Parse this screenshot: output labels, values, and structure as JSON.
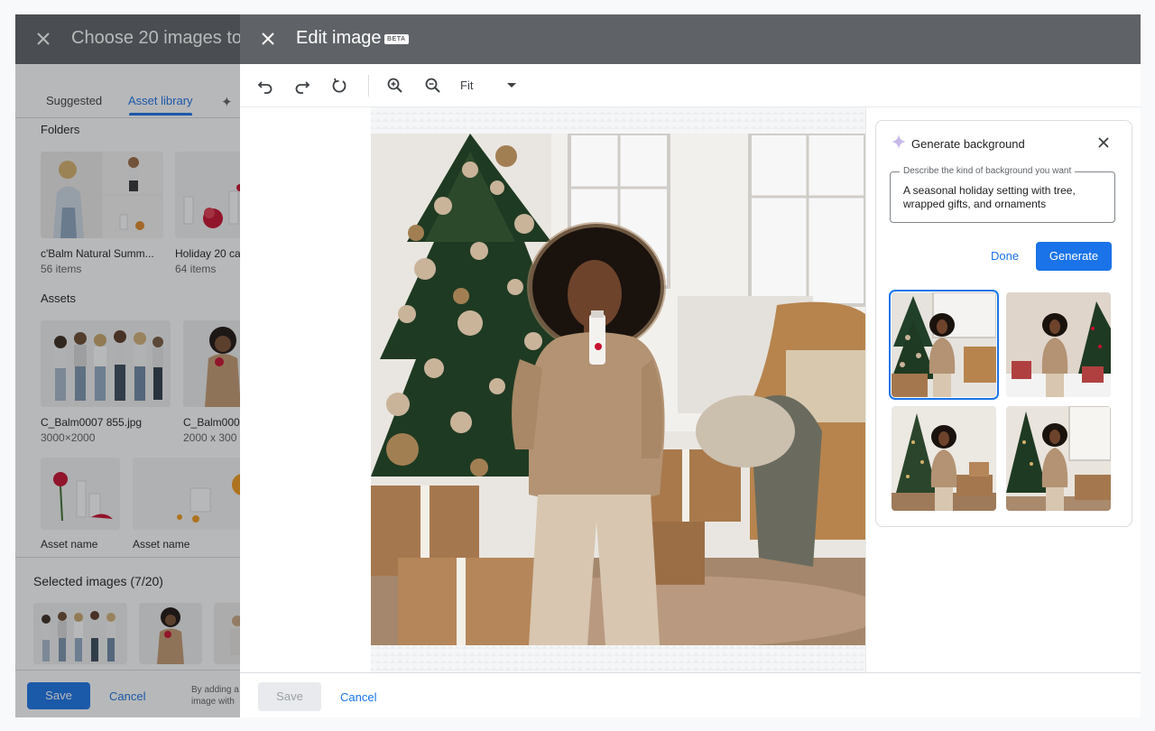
{
  "background_panel": {
    "title": "Choose 20 images to",
    "tabs": [
      {
        "label": "Suggested"
      },
      {
        "label": "Asset library"
      }
    ],
    "folders_label": "Folders",
    "folders": [
      {
        "name": "c'Balm Natural Summ...",
        "count": "56 items"
      },
      {
        "name": "Holiday 20 ca",
        "count": "64 items"
      }
    ],
    "assets_label": "Assets",
    "assets": [
      {
        "name": "C_Balm0007 855.jpg",
        "dims": "3000×2000"
      },
      {
        "name": "C_Balm000",
        "dims": "2000 x 300"
      },
      {
        "name": "Asset name",
        "dims": ""
      },
      {
        "name": "Asset name",
        "dims": ""
      }
    ],
    "selected_title": "Selected images (7/20)",
    "save_label": "Save",
    "cancel_label": "Cancel",
    "note_line1": "By adding a",
    "note_line2": "image with"
  },
  "modal": {
    "title": "Edit image",
    "badge": "BETA",
    "toolbar": {
      "icons": [
        "undo-icon",
        "redo-icon",
        "rotate-icon",
        "zoom-in-icon",
        "zoom-out-icon"
      ],
      "zoom_value": "Fit"
    },
    "generate_panel": {
      "title": "Generate background",
      "prompt_label": "Describe the kind of background you want",
      "prompt_value": "A seasonal holiday setting with tree, wrapped gifts, and ornaments",
      "done_label": "Done",
      "generate_label": "Generate",
      "results_count": 4,
      "selected_index": 0
    },
    "save_label": "Save",
    "cancel_label": "Cancel"
  },
  "colors": {
    "accent": "#1a73e8",
    "header": "#5f6368"
  }
}
